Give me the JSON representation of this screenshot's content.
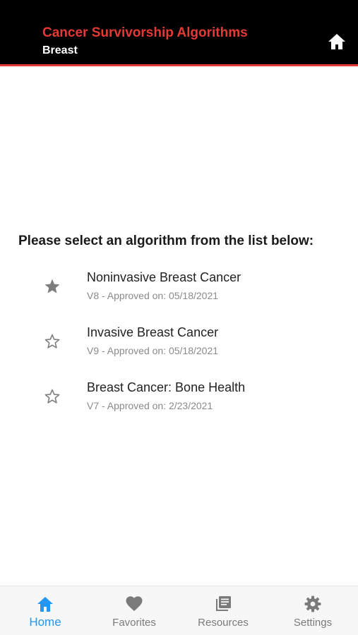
{
  "header": {
    "title": "Cancer Survivorship Algorithms",
    "subtitle": "Breast",
    "home_icon": "home-icon",
    "title_color": "#e53935"
  },
  "main": {
    "prompt": "Please select an algorithm from the list below:",
    "algorithms": [
      {
        "name": "Noninvasive Breast Cancer",
        "version": "V8 - Approved on: 05/18/2021",
        "favorite": true,
        "icon": "star-filled-icon"
      },
      {
        "name": "Invasive Breast Cancer",
        "version": "V9 - Approved on: 05/18/2021",
        "favorite": false,
        "icon": "star-outline-icon"
      },
      {
        "name": "Breast Cancer: Bone Health",
        "version": "V7 - Approved on: 2/23/2021",
        "favorite": false,
        "icon": "star-outline-icon"
      }
    ]
  },
  "tabbar": {
    "active_color": "#2196f3",
    "tabs": [
      {
        "label": "Home",
        "icon": "home-icon",
        "active": true
      },
      {
        "label": "Favorites",
        "icon": "heart-icon",
        "active": false
      },
      {
        "label": "Resources",
        "icon": "book-icon",
        "active": false
      },
      {
        "label": "Settings",
        "icon": "gear-icon",
        "active": false
      }
    ]
  }
}
